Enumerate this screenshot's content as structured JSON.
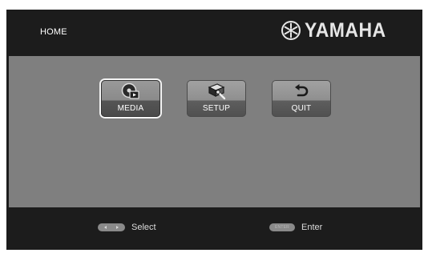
{
  "header": {
    "title": "HOME",
    "brand": "YAMAHA"
  },
  "menu": {
    "items": [
      {
        "label": "MEDIA",
        "icon": "media-icon",
        "selected": true
      },
      {
        "label": "SETUP",
        "icon": "setup-icon",
        "selected": false
      },
      {
        "label": "QUIT",
        "icon": "quit-icon",
        "selected": false
      }
    ]
  },
  "footer": {
    "select_hint": "Select",
    "select_icon": "left-right-arrows-icon",
    "enter_hint": "Enter",
    "enter_key_label": "ENTER"
  },
  "colors": {
    "background": "#1c1c1c",
    "menu_area": "#7f7f7f",
    "selected_outline": "#f4f4f4"
  }
}
